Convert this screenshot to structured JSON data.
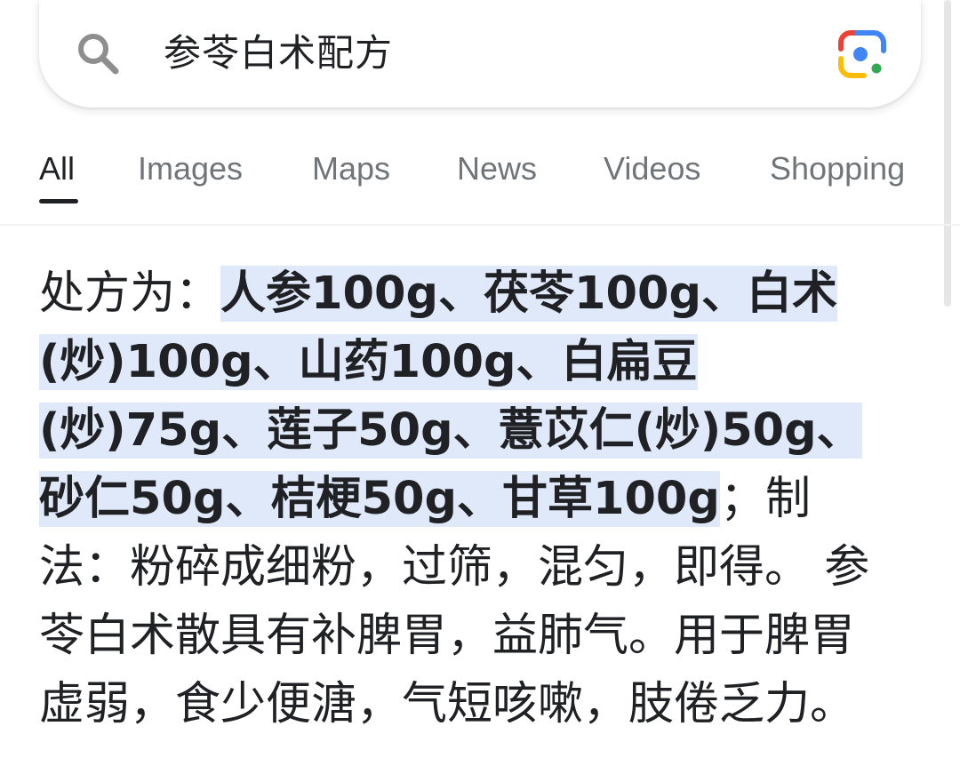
{
  "search": {
    "query": "参苓白术配方"
  },
  "tabs": [
    {
      "label": "All",
      "active": true
    },
    {
      "label": "Images",
      "active": false
    },
    {
      "label": "Maps",
      "active": false
    },
    {
      "label": "News",
      "active": false
    },
    {
      "label": "Videos",
      "active": false
    },
    {
      "label": "Shopping",
      "active": false
    }
  ],
  "snippet": {
    "prefix": "处方为：",
    "highlight": "人参100g、茯苓100g、白术(炒)100g、山药100g、白扁豆(炒)75g、莲子50g、薏苡仁(炒)50g、砂仁50g、桔梗50g、甘草100g",
    "rest": "；制法：粉碎成细粉，过筛，混匀，即得。 参苓白术散具有补脾胃，益肺气。用于脾胃虚弱，食少便溏，气短咳嗽，肢倦乏力。"
  },
  "colors": {
    "highlight": "#e0e9f9",
    "lens_blue": "#4285f4",
    "lens_red": "#ea4335",
    "lens_yellow": "#fbbc04",
    "lens_green": "#34a853"
  },
  "icons": {
    "search": "search-icon",
    "lens": "google-lens-icon"
  }
}
